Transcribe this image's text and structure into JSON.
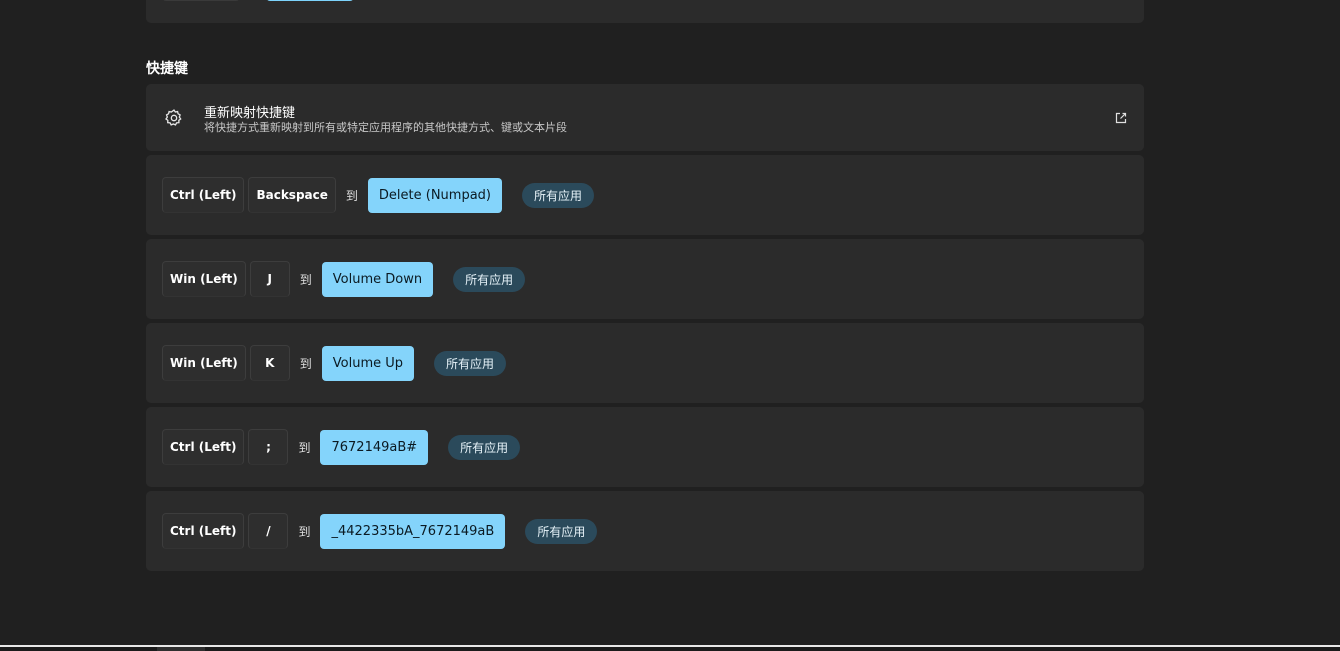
{
  "section": {
    "title": "快捷键"
  },
  "remap_card": {
    "title": "重新映射快捷键",
    "description": "将快捷方式重新映射到所有或特定应用程序的其他快捷方式、键或文本片段",
    "icon": "gear-icon",
    "action_icon": "open-external-icon"
  },
  "mappings": [
    {
      "keys": [
        "Ctrl (Left)",
        "Backspace"
      ],
      "to_label": "到",
      "target": "Delete (Numpad)",
      "scope": "所有应用"
    },
    {
      "keys": [
        "Win (Left)",
        "J"
      ],
      "to_label": "到",
      "target": "Volume Down",
      "scope": "所有应用"
    },
    {
      "keys": [
        "Win (Left)",
        "K"
      ],
      "to_label": "到",
      "target": "Volume Up",
      "scope": "所有应用"
    },
    {
      "keys": [
        "Ctrl (Left)",
        ";"
      ],
      "to_label": "到",
      "target": "7672149aB#",
      "scope": "所有应用"
    },
    {
      "keys": [
        "Ctrl (Left)",
        "/"
      ],
      "to_label": "到",
      "target": "_4422335bA_7672149aB",
      "scope": "所有应用"
    }
  ],
  "colors": {
    "background": "#202020",
    "card": "#2b2b2b",
    "accent": "#84d4fb",
    "badge": "#2b4a5b"
  }
}
